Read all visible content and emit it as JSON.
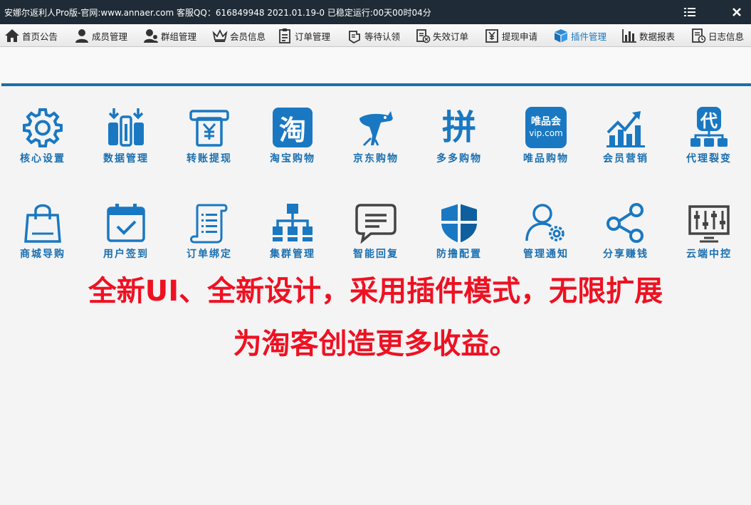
{
  "titlebar": {
    "title": "安娜尔返利人Pro版-官网:www.annaer.com 客服QQ：616849948  2021.01.19-0  已稳定运行:00天00时04分"
  },
  "toolbar": {
    "items": [
      {
        "label": "首页公告",
        "icon": "home-icon"
      },
      {
        "label": "成员管理",
        "icon": "user-icon"
      },
      {
        "label": "群组管理",
        "icon": "group-user-icon"
      },
      {
        "label": "会员信息",
        "icon": "crown-icon"
      },
      {
        "label": "订单管理",
        "icon": "clipboard-list-icon"
      },
      {
        "label": "等待认领",
        "icon": "hand-icon"
      },
      {
        "label": "失效订单",
        "icon": "invalid-order-icon"
      },
      {
        "label": "提现申请",
        "icon": "yen-withdraw-icon"
      },
      {
        "label": "插件管理",
        "icon": "cube-icon",
        "active": true
      },
      {
        "label": "数据报表",
        "icon": "bar-chart-icon"
      },
      {
        "label": "日志信息",
        "icon": "log-icon"
      }
    ]
  },
  "tiles": {
    "row1": [
      {
        "label": "核心设置",
        "icon": "gear-icon"
      },
      {
        "label": "数据管理",
        "icon": "data-bars-icon"
      },
      {
        "label": "转账提现",
        "icon": "yen-atm-icon"
      },
      {
        "label": "淘宝购物",
        "icon": "taobao-icon",
        "glyph": "淘"
      },
      {
        "label": "京东购物",
        "icon": "jd-dog-icon"
      },
      {
        "label": "多多购物",
        "icon": "pinduoduo-icon",
        "glyph": "拼"
      },
      {
        "label": "唯品购物",
        "icon": "vip-icon",
        "glyph": "唯品会",
        "glyph2": "vip.com"
      },
      {
        "label": "会员营销",
        "icon": "growth-chart-icon"
      },
      {
        "label": "代理裂变",
        "icon": "agent-tree-icon",
        "glyph": "代"
      }
    ],
    "row2": [
      {
        "label": "商城导购",
        "icon": "shopping-bag-icon"
      },
      {
        "label": "用户签到",
        "icon": "calendar-check-icon"
      },
      {
        "label": "订单绑定",
        "icon": "order-scroll-icon"
      },
      {
        "label": "集群管理",
        "icon": "cluster-icon"
      },
      {
        "label": "智能回复",
        "icon": "chat-bubble-icon"
      },
      {
        "label": "防撸配置",
        "icon": "shield-icon"
      },
      {
        "label": "管理通知",
        "icon": "user-gear-icon"
      },
      {
        "label": "分享赚钱",
        "icon": "share-icon"
      },
      {
        "label": "云端中控",
        "icon": "control-sliders-icon"
      }
    ]
  },
  "promo": {
    "line1": "全新UI、全新设计，采用插件模式，无限扩展",
    "line2": "为淘客创造更多收益。"
  },
  "colors": {
    "titlebar_bg": "#1f2b36",
    "accent": "#1a78c2",
    "tile_label": "#1a6fb0",
    "promo": "#ee1122"
  }
}
